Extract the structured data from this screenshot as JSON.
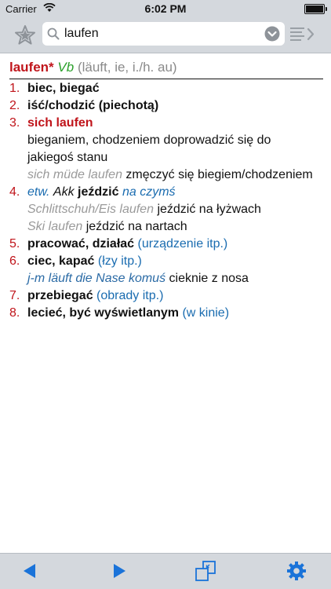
{
  "status": {
    "carrier": "Carrier",
    "time": "6:02 PM"
  },
  "search": {
    "value": "laufen",
    "placeholder": ""
  },
  "entry": {
    "headword": "laufen*",
    "pos": "Vb",
    "grammar": "(läuft, ie, i./h. au)",
    "senses": [
      {
        "num": "1.",
        "text": "biec, biegać"
      },
      {
        "num": "2.",
        "text": "iść/chodzić (piechotą)"
      },
      {
        "num": "3.",
        "phrase": "sich laufen",
        "text": "bieganiem, chodzeniem doprowadzić się do jakiegoś stanu",
        "example_src": "sich müde laufen",
        "example_tgt": "zmęczyć się biegiem/chodzeniem"
      },
      {
        "num": "4.",
        "pre": "etw.",
        "akk": "Akk",
        "text": "jeździć",
        "note": "na czymś",
        "ex1_src": "Schlittschuh/Eis laufen",
        "ex1_tgt": "jeździć na łyżwach",
        "ex2_src": "Ski laufen",
        "ex2_tgt": "jeździć na nartach"
      },
      {
        "num": "5.",
        "text": "pracować, działać",
        "note": "(urządzenie itp.)"
      },
      {
        "num": "6.",
        "text": "ciec, kapać",
        "note": "(łzy itp.)",
        "example_src": "j-m läuft die Nase komuś",
        "example_tgt": "cieknie z nosa"
      },
      {
        "num": "7.",
        "text": "przebiegać",
        "note": "(obrady itp.)"
      },
      {
        "num": "8.",
        "text": "lecieć, być wyświetlanym",
        "note": "(w kinie)"
      }
    ]
  },
  "colors": {
    "bar": "#d4d8dd",
    "accent": "#1a73d9",
    "headword": "#c0151b",
    "pos": "#2aa02a"
  },
  "icons": {
    "favorite": "star-icon",
    "search": "magnifier-icon",
    "dropdown": "chevron-down-circle-icon",
    "list": "list-arrow-icon",
    "back": "triangle-left-icon",
    "forward": "triangle-right-icon",
    "window": "windows-icon",
    "settings": "gear-icon"
  }
}
